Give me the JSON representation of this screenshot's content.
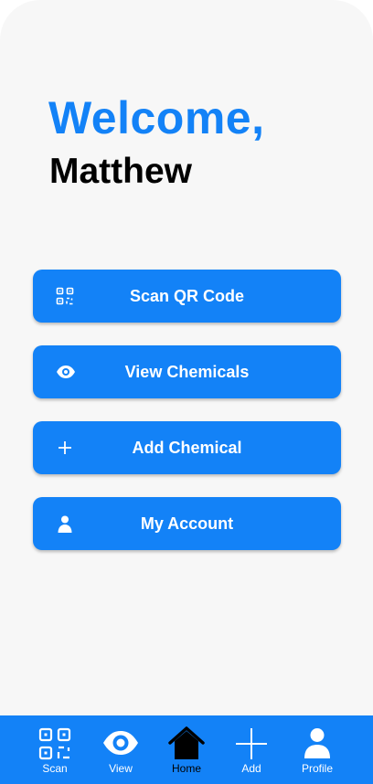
{
  "greeting": {
    "line1": "Welcome,",
    "line2": "Matthew"
  },
  "actions": [
    {
      "label": "Scan QR Code",
      "icon": "qr-code-icon"
    },
    {
      "label": "View Chemicals",
      "icon": "eye-icon"
    },
    {
      "label": "Add Chemical",
      "icon": "plus-icon"
    },
    {
      "label": "My Account",
      "icon": "user-icon"
    }
  ],
  "nav": {
    "items": [
      {
        "label": "Scan",
        "icon": "qr-code-icon",
        "active": false
      },
      {
        "label": "View",
        "icon": "eye-icon",
        "active": false
      },
      {
        "label": "Home",
        "icon": "home-icon",
        "active": true
      },
      {
        "label": "Add",
        "icon": "plus-icon",
        "active": false
      },
      {
        "label": "Profile",
        "icon": "user-icon",
        "active": false
      }
    ]
  },
  "colors": {
    "accent": "#1382f7",
    "background": "#f7f7f7",
    "active_nav": "#000000"
  }
}
